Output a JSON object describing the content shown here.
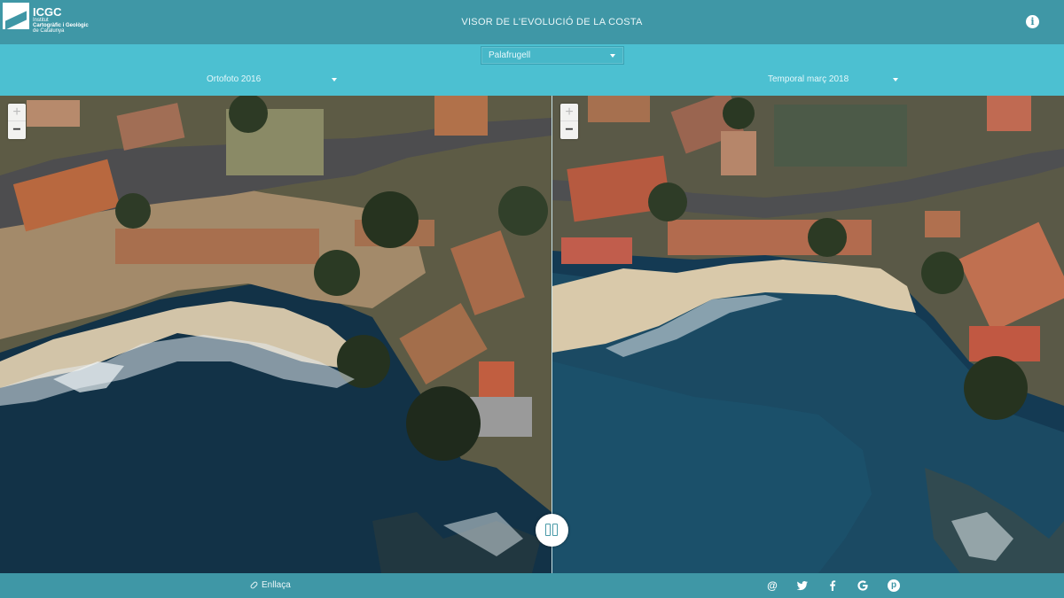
{
  "header": {
    "logo_title": "ICGC",
    "logo_lines": [
      "Institut",
      "Cartogràfic i Geològic",
      "de Catalunya"
    ],
    "app_title": "VISOR DE L'EVOLUCIÓ DE LA COSTA",
    "info_icon": "info-icon"
  },
  "location_select": {
    "value": "Palafrugell"
  },
  "layers": {
    "left": "Ortofoto 2016",
    "right": "Temporal març 2018"
  },
  "map": {
    "zoom_in": "+",
    "zoom_out": "−",
    "swipe_icon": "split-view-icon"
  },
  "footer": {
    "link_label": "Enllaça",
    "social": [
      "@",
      "twitter-icon",
      "facebook-icon",
      "google-icon",
      "pinterest-icon"
    ]
  },
  "colors": {
    "header": "#3f97a6",
    "select_bar": "#4cc0d1",
    "sea_dark": "#0f2b3f",
    "sand": "#d8c9ad",
    "roof": "#b86a4a"
  }
}
